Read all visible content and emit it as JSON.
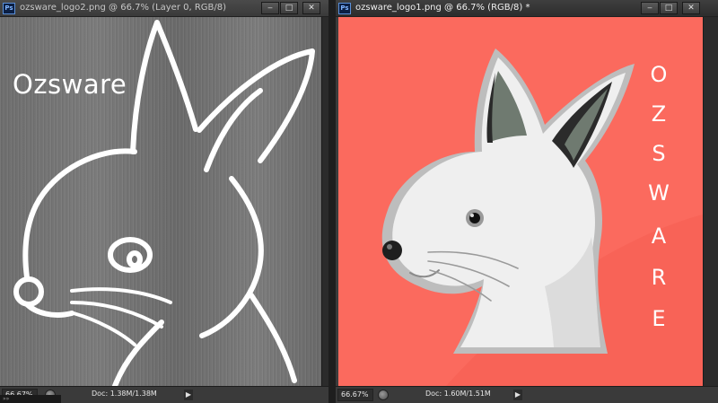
{
  "left_window": {
    "title": "ozsware_logo2.png @ 66.7% (Layer 0, RGB/8)",
    "app_icon": "Ps",
    "minimize": "‒",
    "maximize": "□",
    "close": "✕",
    "brand_text": "Ozsware",
    "zoom": "66.67%",
    "doc_info": "Doc: 1.38M/1.38M",
    "mini_tab": "»»"
  },
  "right_window": {
    "title": "ozsware_logo1.png @ 66.7% (RGB/8) *",
    "app_icon": "Ps",
    "minimize": "‒",
    "maximize": "□",
    "close": "✕",
    "brand_letters": [
      "O",
      "Z",
      "S",
      "W",
      "A",
      "R",
      "E"
    ],
    "zoom": "66.67%",
    "doc_info": "Doc: 1.60M/1.51M"
  },
  "colors": {
    "coral_background": "#fb6a5e",
    "metal_background": "#747474",
    "line_art": "#ffffff",
    "fur": "#efefef",
    "shadow": "#c8c8c8",
    "inner_ear": "#6f7a70"
  },
  "icons": [
    "photoshop-icon",
    "minimize-icon",
    "maximize-icon",
    "close-icon",
    "status-icon",
    "arrow-right-icon"
  ]
}
